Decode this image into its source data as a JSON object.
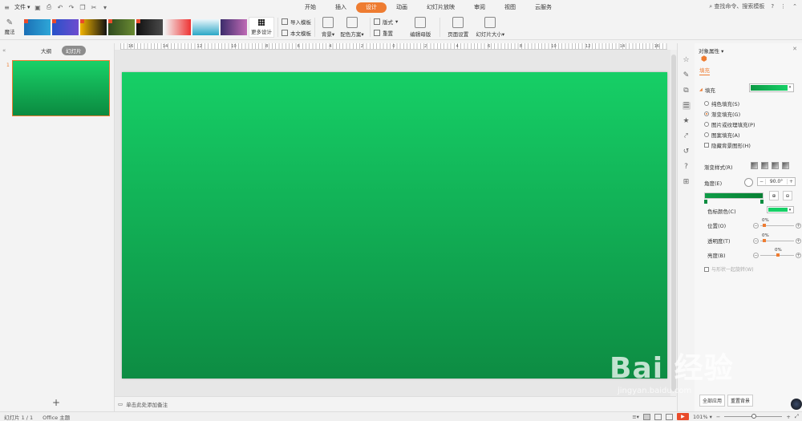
{
  "menubar": {
    "file_label": "文件",
    "tabs": [
      "开始",
      "插入",
      "设计",
      "动画",
      "幻灯片放映",
      "审阅",
      "视图",
      "云服务"
    ],
    "active_tab": "设计",
    "search_placeholder": "查找命令、搜索模板",
    "help": "?",
    "more": "⋮"
  },
  "ribbon": {
    "magic_label": "魔法",
    "more_design_label": "更多设计",
    "import_template_label": "导入模板",
    "text_template_label": "本文模板",
    "background_label": "背景",
    "color_scheme_label": "配色方案",
    "layout_label": "版式",
    "reset_label": "重置",
    "edit_master_label": "编辑母版",
    "page_setup_label": "页面设置",
    "slide_size_label": "幻灯片大小"
  },
  "leftpanel": {
    "tab_outline": "大纲",
    "tab_slides": "幻灯片",
    "slide_number": "1",
    "add_label": "+"
  },
  "ruler": {
    "numbers": [
      "16",
      "14",
      "12",
      "10",
      "8",
      "6",
      "4",
      "2",
      "0",
      "2",
      "4",
      "6",
      "8",
      "10",
      "12",
      "14",
      "16"
    ]
  },
  "notes": {
    "placeholder": "单击此处添加备注"
  },
  "props": {
    "title": "对象属性",
    "tab_fill": "填充",
    "section_fill": "填充",
    "options": [
      {
        "label": "纯色填充(S)",
        "type": "radio",
        "selected": false
      },
      {
        "label": "渐变填充(G)",
        "type": "radio",
        "selected": true
      },
      {
        "label": "图片或纹理填充(P)",
        "type": "radio",
        "selected": false
      },
      {
        "label": "图案填充(A)",
        "type": "radio",
        "selected": false
      },
      {
        "label": "隐藏背景图形(H)",
        "type": "check",
        "selected": false
      }
    ],
    "gradient_style_label": "渐变样式(R)",
    "angle_label": "角度(E)",
    "angle_value": "90.0°",
    "stop_color_label": "色标颜色(C)",
    "position_label": "位置(O)",
    "position_value": "0%",
    "transparency_label": "透明度(T)",
    "transparency_value": "0%",
    "brightness_label": "亮度(B)",
    "brightness_value": "0%",
    "rotate_with_shape_label": "与形状一起旋转(W)",
    "apply_all_label": "全部应用",
    "reset_bg_label": "重置背景",
    "fill_color_start": "#0c9a45",
    "fill_color_end": "#17d067",
    "stop_color": "#17d067"
  },
  "slide": {
    "gradient_top": "#16cf66",
    "gradient_bottom": "#0d8c43"
  },
  "statusbar": {
    "slide_count": "幻灯片 1 / 1",
    "theme": "Office 主题",
    "zoom": "101%",
    "zoom_minus": "−",
    "zoom_plus": "+"
  },
  "watermark": {
    "text": "Bai 经验",
    "url": "jingyan.baidu.com"
  }
}
